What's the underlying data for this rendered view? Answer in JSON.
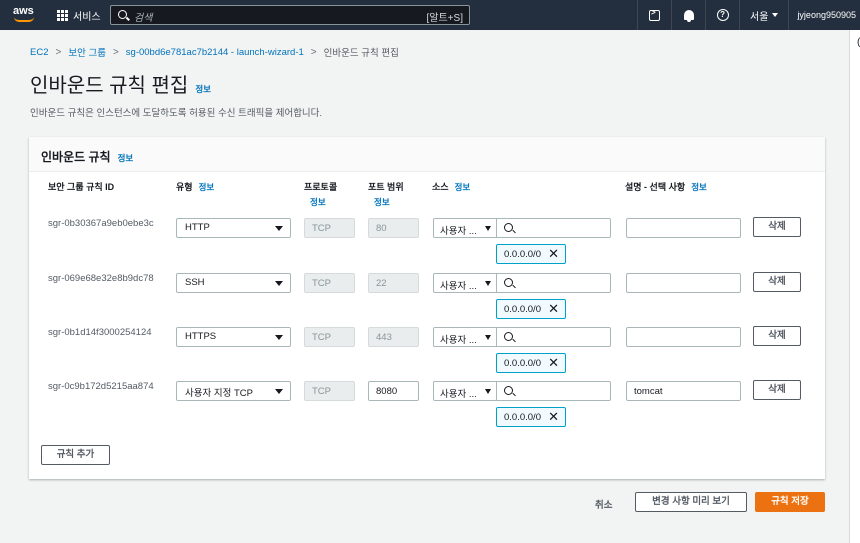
{
  "topnav": {
    "logo_text": "aws",
    "services_label": "서비스",
    "search_placeholder": "검색",
    "search_shortcut": "[알트+S]",
    "region": "서울",
    "account": "jyjeong950905"
  },
  "breadcrumb": {
    "items": [
      "EC2",
      "보안 그룹",
      "sg-00bd6e781ac7b2144 - launch-wizard-1"
    ],
    "current": "인바운드 규칙 편집"
  },
  "page": {
    "title": "인바운드 규칙 편집",
    "info": "정보",
    "description": "인바운드 규칙은 인스턴스에 도달하도록 허용된 수신 트래픽을 제어합니다."
  },
  "panel": {
    "title": "인바운드 규칙",
    "info": "정보",
    "columns": {
      "rule_id": "보안 그룹 규칙 ID",
      "type": "유형",
      "protocol": "프로토콜",
      "port_range": "포트 범위",
      "source": "소스",
      "description": "설명 - 선택 사항",
      "info": "정보"
    },
    "rules": [
      {
        "id": "sgr-0b30367a9eb0ebe3c",
        "type": "HTTP",
        "protocol": "TCP",
        "port": "80",
        "source_type": "사용자 ...",
        "cidr": "0.0.0.0/0",
        "description": "",
        "delete": "삭제"
      },
      {
        "id": "sgr-069e68e32e8b9dc78",
        "type": "SSH",
        "protocol": "TCP",
        "port": "22",
        "source_type": "사용자 ...",
        "cidr": "0.0.0.0/0",
        "description": "",
        "delete": "삭제"
      },
      {
        "id": "sgr-0b1d14f3000254124",
        "type": "HTTPS",
        "protocol": "TCP",
        "port": "443",
        "source_type": "사용자 ...",
        "cidr": "0.0.0.0/0",
        "description": "",
        "delete": "삭제"
      },
      {
        "id": "sgr-0c9b172d5215aa874",
        "type": "사용자 지정 TCP",
        "protocol": "TCP",
        "port": "8080",
        "source_type": "사용자 ...",
        "cidr": "0.0.0.0/0",
        "description": "tomcat",
        "delete": "삭제"
      }
    ],
    "add_rule": "규칙 추가"
  },
  "footer": {
    "cancel": "취소",
    "preview": "변경 사항 미리 보기",
    "save": "규칙 저장"
  },
  "colors": {
    "nav_bg": "#232f3e",
    "link": "#0073bb",
    "primary": "#ec7211",
    "token_border": "#00a1c9"
  }
}
